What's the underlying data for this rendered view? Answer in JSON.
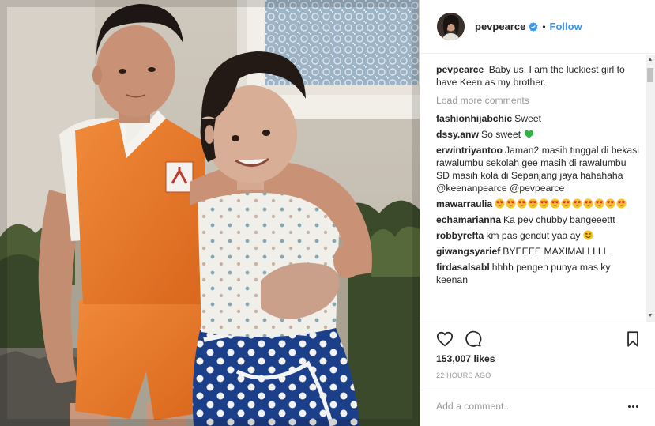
{
  "post": {
    "username": "pevpearce",
    "verified": true,
    "follow_label": "Follow",
    "dot": "•"
  },
  "comments": {
    "caption": {
      "user": "pevpearce",
      "text": "Baby us. I am the luckiest girl to have Keen as my brother."
    },
    "load_more": "Load more comments",
    "items": [
      {
        "user": "fashionhijabchic",
        "text": "Sweet",
        "emoji": []
      },
      {
        "user": "dssy.anw",
        "text": "So sweet",
        "emoji": [
          "green-heart"
        ]
      },
      {
        "user": "erwintriyantoo",
        "text": "Jaman2 masih tinggal di bekasi rawalumbu sekolah gee masih di rawalumbu SD masih kola di Sepanjang jaya hahahaha @keenanpearce @pevpearce",
        "emoji": []
      },
      {
        "user": "mawarraulia",
        "text": "",
        "emoji": [
          "heart-eyes",
          "heart-eyes",
          "heart-eyes",
          "heart-eyes",
          "heart-eyes",
          "heart-eyes",
          "heart-eyes",
          "heart-eyes",
          "heart-eyes",
          "heart-eyes",
          "heart-eyes",
          "heart-eyes"
        ]
      },
      {
        "user": "echamarianna",
        "text": "Ka pev chubby bangeeettt",
        "emoji": []
      },
      {
        "user": "robbyrefta",
        "text": "km pas gendut yaa ay",
        "emoji": [
          "grin-sweat"
        ]
      },
      {
        "user": "giwangsyarief",
        "text": "BYEEEE MAXIMALLLLL",
        "emoji": []
      },
      {
        "user": "firdasalsabl",
        "text": "hhhh pengen punya mas ky keenan",
        "emoji": []
      }
    ]
  },
  "actions": {
    "like_icon": "heart-outline-icon",
    "comment_icon": "speech-bubble-icon",
    "save_icon": "bookmark-icon"
  },
  "likes_text": "153,007 likes",
  "time_text": "22 HOURS AGO",
  "add_comment": {
    "placeholder": "Add a comment...",
    "more_icon": "ellipsis-icon"
  },
  "colors": {
    "link": "#3897f0",
    "muted": "#999999",
    "text": "#262626",
    "border": "#efefef"
  }
}
